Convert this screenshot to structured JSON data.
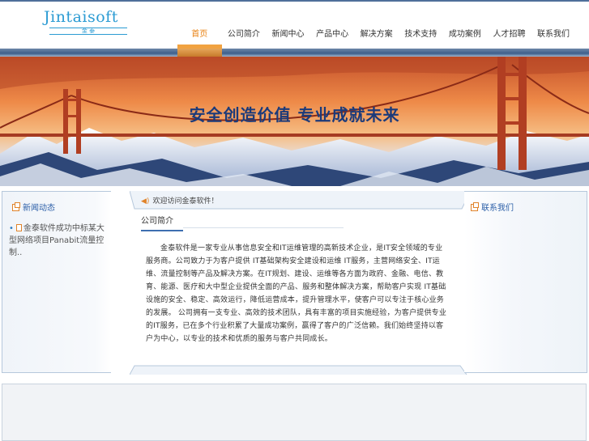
{
  "logo": {
    "wordmark": "Jintaisoft",
    "subtitle": "金 泰"
  },
  "nav": {
    "items": [
      {
        "label": "首页",
        "active": true
      },
      {
        "label": "公司简介",
        "active": false
      },
      {
        "label": "新闻中心",
        "active": false
      },
      {
        "label": "产品中心",
        "active": false
      },
      {
        "label": "解决方案",
        "active": false
      },
      {
        "label": "技术支持",
        "active": false
      },
      {
        "label": "成功案例",
        "active": false
      },
      {
        "label": "人才招聘",
        "active": false
      },
      {
        "label": "联系我们",
        "active": false
      }
    ]
  },
  "banner": {
    "slogan": "安全创造价值    专业成就未来"
  },
  "left_panel": {
    "title": "新闻动态",
    "news": [
      "金泰软件成功中标某大型网络项目Panabit流量控制.."
    ]
  },
  "center": {
    "header": "欢迎访问金泰软件！",
    "section_title": "公司简介",
    "body": "金泰软件是一家专业从事信息安全和IT运维管理的高新技术企业，是IT安全领域的专业服务商。公司致力于为客户提供 IT基础架构安全建设和运维 IT服务，主营网络安全、IT运维、流量控制等产品及解决方案。在IT规划、建设、运维等各方面为政府、金融、电信、教育、能源、医疗和大中型企业提供全面的产品、服务和整体解决方案，帮助客户实现 IT基础设施的安全、稳定、高效运行，降低运营成本，提升管理水平，使客户可以专注于核心业务的发展。 公司拥有一支专业、高效的技术团队，具有丰富的项目实施经验，为客户提供专业的IT服务，已在多个行业积累了大量成功案例，赢得了客户的广泛信赖。我们始终坚持以客户为中心，以专业的技术和优质的服务与客户共同成长。"
  },
  "right_panel": {
    "title": "联系我们"
  },
  "colors": {
    "accent": "#e88010",
    "brand": "#2b9bd3",
    "nav_bar": "#3e5f8c",
    "link_title": "#2c5fa8"
  }
}
